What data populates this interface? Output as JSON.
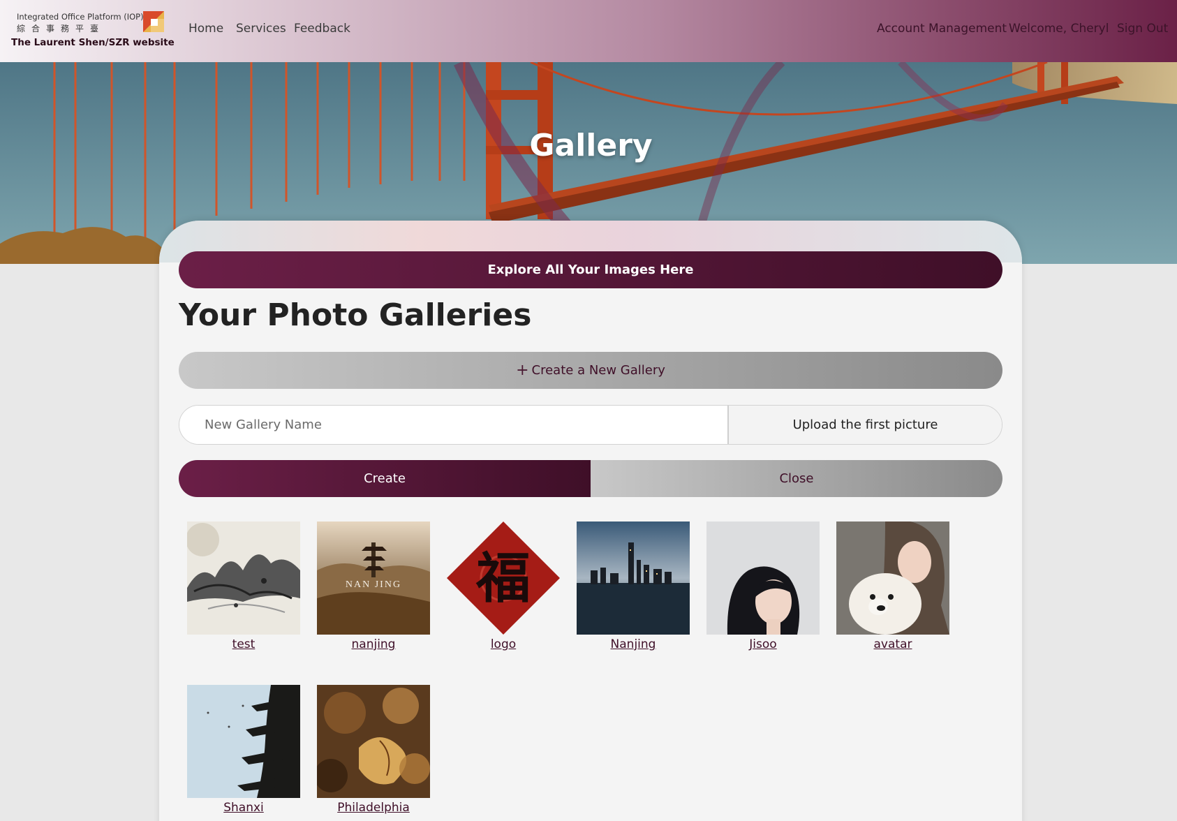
{
  "navbar": {
    "brand_line1": "Integrated Office Platform (IOP)",
    "brand_line2": "綜合事務平臺",
    "brand_line3": "The Laurent Shen/SZR website",
    "links": [
      "Home",
      "Services",
      "Feedback"
    ],
    "account": "Account Management",
    "welcome": "Welcome, Cheryl",
    "signout": "Sign Out"
  },
  "hero": {
    "title": "Gallery"
  },
  "main": {
    "explore_label": "Explore All Your Images Here",
    "section_title": "Your Photo Galleries",
    "create_toggle_label": "Create a New Gallery",
    "gallery_name_placeholder": "New Gallery Name",
    "upload_label": "Upload the first picture",
    "create_label": "Create",
    "close_label": "Close"
  },
  "galleries": [
    {
      "name": "test",
      "icon": "ink-mountain-image"
    },
    {
      "name": "nanjing",
      "icon": "pagoda-landscape-image",
      "caption": "NAN JING"
    },
    {
      "name": "logo",
      "icon": "fu-character-image",
      "glyph": "福"
    },
    {
      "name": "Nanjing",
      "icon": "city-skyline-image"
    },
    {
      "name": "Jisoo",
      "icon": "portrait-image"
    },
    {
      "name": "avatar",
      "icon": "puppy-portrait-image"
    },
    {
      "name": "Shanxi",
      "icon": "pagoda-eaves-image"
    },
    {
      "name": "Philadelphia",
      "icon": "autumn-leaves-image"
    }
  ],
  "colors": {
    "brand_primary": "#6b1f47",
    "brand_dark": "#3f0f28",
    "link_color": "#3f0f28",
    "page_background": "#e8e8e8",
    "card_background": "#f4f4f4"
  }
}
